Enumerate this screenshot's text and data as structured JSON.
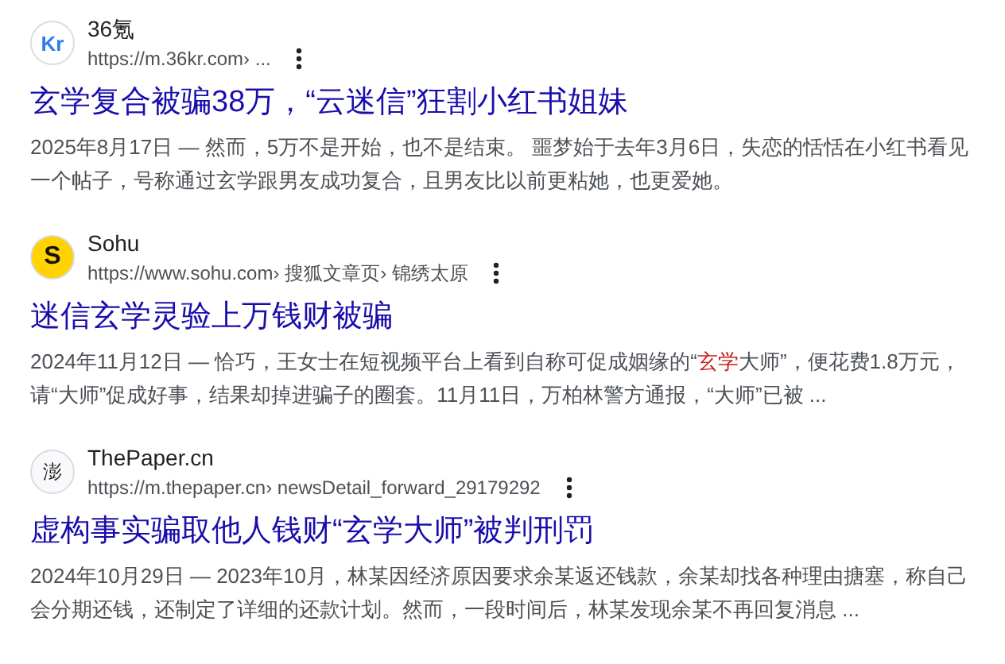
{
  "results": [
    {
      "site": "36氪",
      "favicon": "Kr",
      "kind": "kr",
      "url": "https://m.36kr.com",
      "path": [
        "› ..."
      ],
      "title": "玄学复合被骗38万，“云迷信”狂割小红书姐妹",
      "snippet": [
        {
          "text": "2025年8月17日 — 然而，5万不是开始，也不是结束。 噩梦始于去年3月6日，失恋的恬恬在小红书看见一个帖子，号称通过玄学跟男友成功复合，且男友比以前更粘她，也更爱她。",
          "highlight": false
        }
      ]
    },
    {
      "site": "Sohu",
      "favicon": "S",
      "kind": "sohu",
      "url": "https://www.sohu.com",
      "path": [
        "› 搜狐文章页",
        "› 锦绣太原"
      ],
      "title": "迷信玄学灵验上万钱财被骗",
      "snippet": [
        {
          "text": "2024年11月12日 — 恰巧，王女士在短视频平台上看到自称可促成姻缘的“",
          "highlight": false
        },
        {
          "text": "玄学",
          "highlight": true
        },
        {
          "text": "大师”，便花费1.8万元，请“大师”促成好事，结果却掉进骗子的圈套。11月11日，万柏林警方通报，“大师”已被 ...",
          "highlight": false
        }
      ]
    },
    {
      "site": "ThePaper.cn",
      "favicon": "澎",
      "kind": "paper",
      "url": "https://m.thepaper.cn",
      "path": [
        "› newsDetail_forward_29179292"
      ],
      "title": "虚构事实骗取他人钱财“玄学大师”被判刑罚",
      "snippet": [
        {
          "text": "2024年10月29日 — 2023年10月，林某因经济原因要求余某返还钱款，余某却找各种理由搪塞，称自己会分期还钱，还制定了详细的还款计划。然而，一段时间后，林某发现余某不再回复消息 ...",
          "highlight": false
        }
      ]
    }
  ]
}
